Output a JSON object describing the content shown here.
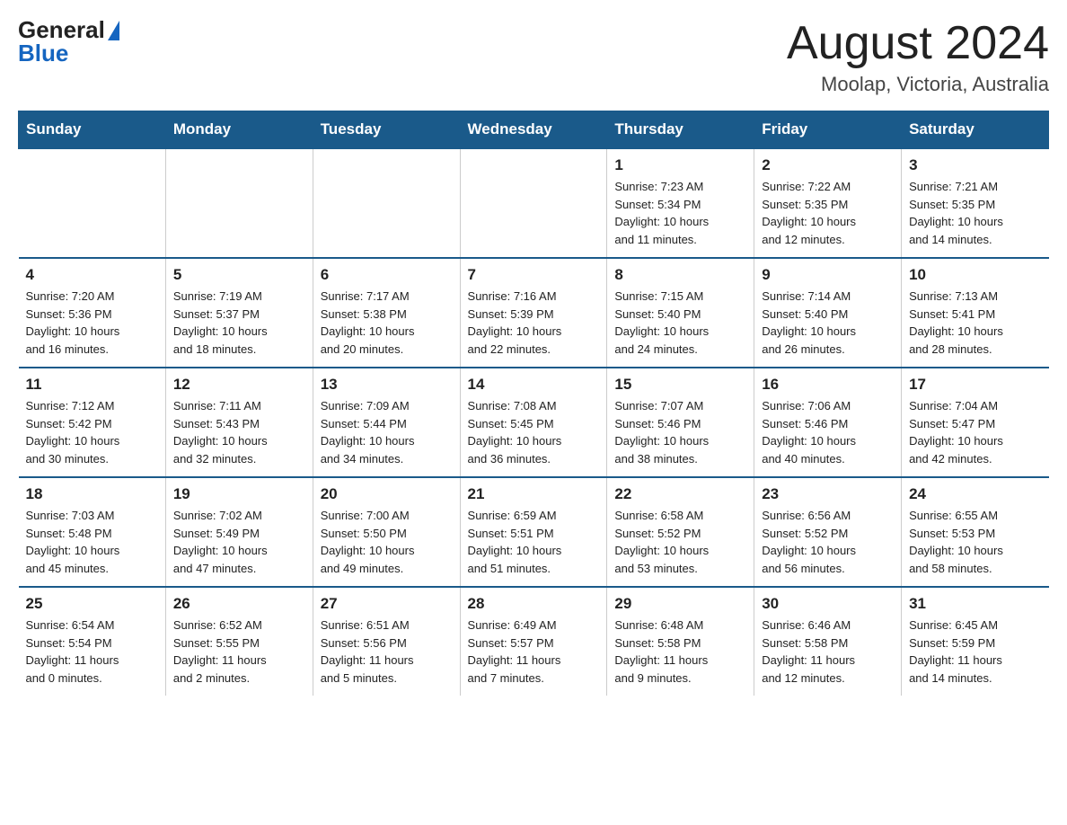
{
  "logo": {
    "general": "General",
    "blue": "Blue"
  },
  "title": "August 2024",
  "location": "Moolap, Victoria, Australia",
  "days_of_week": [
    "Sunday",
    "Monday",
    "Tuesday",
    "Wednesday",
    "Thursday",
    "Friday",
    "Saturday"
  ],
  "weeks": [
    [
      {
        "day": "",
        "info": ""
      },
      {
        "day": "",
        "info": ""
      },
      {
        "day": "",
        "info": ""
      },
      {
        "day": "",
        "info": ""
      },
      {
        "day": "1",
        "info": "Sunrise: 7:23 AM\nSunset: 5:34 PM\nDaylight: 10 hours\nand 11 minutes."
      },
      {
        "day": "2",
        "info": "Sunrise: 7:22 AM\nSunset: 5:35 PM\nDaylight: 10 hours\nand 12 minutes."
      },
      {
        "day": "3",
        "info": "Sunrise: 7:21 AM\nSunset: 5:35 PM\nDaylight: 10 hours\nand 14 minutes."
      }
    ],
    [
      {
        "day": "4",
        "info": "Sunrise: 7:20 AM\nSunset: 5:36 PM\nDaylight: 10 hours\nand 16 minutes."
      },
      {
        "day": "5",
        "info": "Sunrise: 7:19 AM\nSunset: 5:37 PM\nDaylight: 10 hours\nand 18 minutes."
      },
      {
        "day": "6",
        "info": "Sunrise: 7:17 AM\nSunset: 5:38 PM\nDaylight: 10 hours\nand 20 minutes."
      },
      {
        "day": "7",
        "info": "Sunrise: 7:16 AM\nSunset: 5:39 PM\nDaylight: 10 hours\nand 22 minutes."
      },
      {
        "day": "8",
        "info": "Sunrise: 7:15 AM\nSunset: 5:40 PM\nDaylight: 10 hours\nand 24 minutes."
      },
      {
        "day": "9",
        "info": "Sunrise: 7:14 AM\nSunset: 5:40 PM\nDaylight: 10 hours\nand 26 minutes."
      },
      {
        "day": "10",
        "info": "Sunrise: 7:13 AM\nSunset: 5:41 PM\nDaylight: 10 hours\nand 28 minutes."
      }
    ],
    [
      {
        "day": "11",
        "info": "Sunrise: 7:12 AM\nSunset: 5:42 PM\nDaylight: 10 hours\nand 30 minutes."
      },
      {
        "day": "12",
        "info": "Sunrise: 7:11 AM\nSunset: 5:43 PM\nDaylight: 10 hours\nand 32 minutes."
      },
      {
        "day": "13",
        "info": "Sunrise: 7:09 AM\nSunset: 5:44 PM\nDaylight: 10 hours\nand 34 minutes."
      },
      {
        "day": "14",
        "info": "Sunrise: 7:08 AM\nSunset: 5:45 PM\nDaylight: 10 hours\nand 36 minutes."
      },
      {
        "day": "15",
        "info": "Sunrise: 7:07 AM\nSunset: 5:46 PM\nDaylight: 10 hours\nand 38 minutes."
      },
      {
        "day": "16",
        "info": "Sunrise: 7:06 AM\nSunset: 5:46 PM\nDaylight: 10 hours\nand 40 minutes."
      },
      {
        "day": "17",
        "info": "Sunrise: 7:04 AM\nSunset: 5:47 PM\nDaylight: 10 hours\nand 42 minutes."
      }
    ],
    [
      {
        "day": "18",
        "info": "Sunrise: 7:03 AM\nSunset: 5:48 PM\nDaylight: 10 hours\nand 45 minutes."
      },
      {
        "day": "19",
        "info": "Sunrise: 7:02 AM\nSunset: 5:49 PM\nDaylight: 10 hours\nand 47 minutes."
      },
      {
        "day": "20",
        "info": "Sunrise: 7:00 AM\nSunset: 5:50 PM\nDaylight: 10 hours\nand 49 minutes."
      },
      {
        "day": "21",
        "info": "Sunrise: 6:59 AM\nSunset: 5:51 PM\nDaylight: 10 hours\nand 51 minutes."
      },
      {
        "day": "22",
        "info": "Sunrise: 6:58 AM\nSunset: 5:52 PM\nDaylight: 10 hours\nand 53 minutes."
      },
      {
        "day": "23",
        "info": "Sunrise: 6:56 AM\nSunset: 5:52 PM\nDaylight: 10 hours\nand 56 minutes."
      },
      {
        "day": "24",
        "info": "Sunrise: 6:55 AM\nSunset: 5:53 PM\nDaylight: 10 hours\nand 58 minutes."
      }
    ],
    [
      {
        "day": "25",
        "info": "Sunrise: 6:54 AM\nSunset: 5:54 PM\nDaylight: 11 hours\nand 0 minutes."
      },
      {
        "day": "26",
        "info": "Sunrise: 6:52 AM\nSunset: 5:55 PM\nDaylight: 11 hours\nand 2 minutes."
      },
      {
        "day": "27",
        "info": "Sunrise: 6:51 AM\nSunset: 5:56 PM\nDaylight: 11 hours\nand 5 minutes."
      },
      {
        "day": "28",
        "info": "Sunrise: 6:49 AM\nSunset: 5:57 PM\nDaylight: 11 hours\nand 7 minutes."
      },
      {
        "day": "29",
        "info": "Sunrise: 6:48 AM\nSunset: 5:58 PM\nDaylight: 11 hours\nand 9 minutes."
      },
      {
        "day": "30",
        "info": "Sunrise: 6:46 AM\nSunset: 5:58 PM\nDaylight: 11 hours\nand 12 minutes."
      },
      {
        "day": "31",
        "info": "Sunrise: 6:45 AM\nSunset: 5:59 PM\nDaylight: 11 hours\nand 14 minutes."
      }
    ]
  ]
}
